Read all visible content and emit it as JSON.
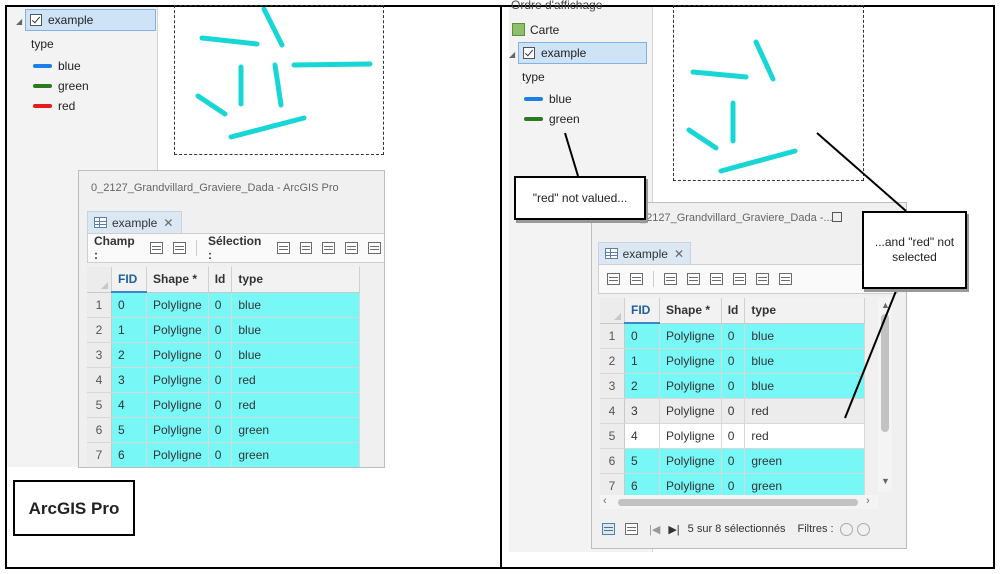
{
  "left": {
    "toc": {
      "layer_name": "example",
      "field_label": "type",
      "legend": [
        {
          "label": "blue",
          "color": "#1a7fe8"
        },
        {
          "label": "green",
          "color": "#2a7a1e"
        },
        {
          "label": "red",
          "color": "#e81a1a"
        }
      ]
    },
    "window": {
      "title": "0_2127_Grandvillard_Graviere_Dada - ArcGIS Pro",
      "tab_label": "example",
      "tab_close": "✕",
      "champ_label": "Champ :",
      "selection_label": "Sélection :"
    },
    "table": {
      "columns": [
        "FID",
        "Shape *",
        "Id",
        "type"
      ],
      "rows": [
        {
          "n": "1",
          "fid": "0",
          "shape": "Polyligne",
          "id": "0",
          "type": "blue"
        },
        {
          "n": "2",
          "fid": "1",
          "shape": "Polyligne",
          "id": "0",
          "type": "blue"
        },
        {
          "n": "3",
          "fid": "2",
          "shape": "Polyligne",
          "id": "0",
          "type": "blue"
        },
        {
          "n": "4",
          "fid": "3",
          "shape": "Polyligne",
          "id": "0",
          "type": "red"
        },
        {
          "n": "5",
          "fid": "4",
          "shape": "Polyligne",
          "id": "0",
          "type": "red"
        },
        {
          "n": "6",
          "fid": "5",
          "shape": "Polyligne",
          "id": "0",
          "type": "green"
        },
        {
          "n": "7",
          "fid": "6",
          "shape": "Polyligne",
          "id": "0",
          "type": "green"
        }
      ]
    },
    "caption": "ArcGIS Pro"
  },
  "right": {
    "toc": {
      "header_partial": "Ordre d'affichage",
      "map_label": "Carte",
      "layer_name": "example",
      "field_label": "type",
      "legend": [
        {
          "label": "blue",
          "color": "#1a7fe8"
        },
        {
          "label": "green",
          "color": "#2a7a1e"
        }
      ]
    },
    "window": {
      "title": "_2127_Grandvillard_Graviere_Dada -...",
      "tab_label": "example",
      "tab_close": "✕",
      "status": "5 sur 8 sélectionnés",
      "filters_label": "Filtres :"
    },
    "table": {
      "columns": [
        "FID",
        "Shape *",
        "Id",
        "type"
      ],
      "rows": [
        {
          "n": "1",
          "fid": "0",
          "shape": "Polyligne",
          "id": "0",
          "type": "blue"
        },
        {
          "n": "2",
          "fid": "1",
          "shape": "Polyligne",
          "id": "0",
          "type": "blue"
        },
        {
          "n": "3",
          "fid": "2",
          "shape": "Polyligne",
          "id": "0",
          "type": "blue"
        },
        {
          "n": "4",
          "fid": "3",
          "shape": "Polyligne",
          "id": "0",
          "type": "red"
        },
        {
          "n": "5",
          "fid": "4",
          "shape": "Polyligne",
          "id": "0",
          "type": "red"
        },
        {
          "n": "6",
          "fid": "5",
          "shape": "Polyligne",
          "id": "0",
          "type": "green"
        },
        {
          "n": "7",
          "fid": "6",
          "shape": "Polyligne",
          "id": "0",
          "type": "green"
        }
      ]
    },
    "callout_not_valued": "\"red\" not valued...",
    "callout_not_selected": "...and \"red\" not selected"
  },
  "colors": {
    "selection": "#78f7f7",
    "feature": "#19d6d6"
  }
}
